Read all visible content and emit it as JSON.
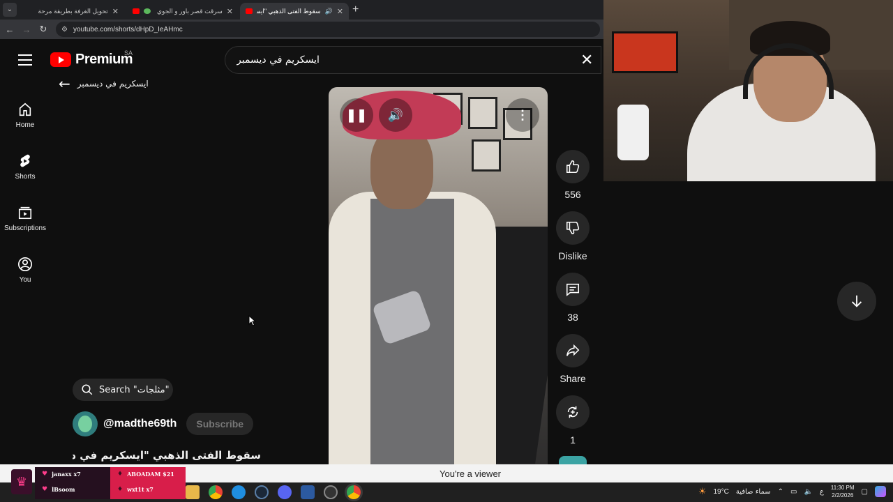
{
  "browser": {
    "tabs": [
      {
        "title": "تحويل الغرفة بطريقة مرحة"
      },
      {
        "title": "سرقت قصر باور و الجوي اوردز"
      },
      {
        "title": "سقوط الفتى الذهبي \"ايسكر"
      }
    ],
    "url": "youtube.com/shorts/dHpD_IeAHmc"
  },
  "youtube": {
    "logo_text": "Premium",
    "country": "SA",
    "search_value": "ايسكريم في ديسمبر",
    "back_title": "ايسكريم في ديسمبر",
    "guide": [
      {
        "label": "Home",
        "icon": "home-icon"
      },
      {
        "label": "Shorts",
        "icon": "shorts-icon"
      },
      {
        "label": "Subscriptions",
        "icon": "subscriptions-icon"
      },
      {
        "label": "You",
        "icon": "you-icon"
      }
    ],
    "actions": {
      "like_count": "556",
      "dislike_label": "Dislike",
      "comment_count": "38",
      "share_label": "Share",
      "remix_count": "1"
    },
    "pill_search": "Search \"مثلجات\"",
    "channel": "@madthe69th",
    "subscribe_label": "Subscribe",
    "video_title": "سقوط الفتى الذهبي \"ايسكريم في ديسمبر\""
  },
  "viewer_text": "You're a viewer",
  "donations": {
    "col_a": [
      "janaxx x7",
      "lBsoom"
    ],
    "col_b": [
      "ABOADAM $21",
      "wxt1t x7"
    ]
  },
  "taskbar": {
    "weather": "19°C",
    "weather_desc": "سماء صافية",
    "lang": "ع",
    "time": "11:30 PM",
    "date": "2/2/2026"
  }
}
